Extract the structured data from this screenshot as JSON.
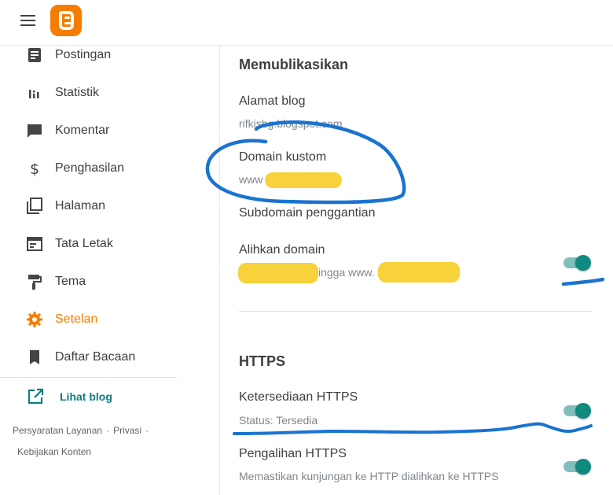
{
  "colors": {
    "accent": "#f57d00",
    "teal": "#0f7c80",
    "toggle_on": "#0f8a7e",
    "annotation": "#1a73d0",
    "redaction": "#f7d23a"
  },
  "sidebar": {
    "items": [
      {
        "label": "Postingan",
        "icon": "posts-icon"
      },
      {
        "label": "Statistik",
        "icon": "stats-icon"
      },
      {
        "label": "Komentar",
        "icon": "comment-icon"
      },
      {
        "label": "Penghasilan",
        "icon": "dollar-icon"
      },
      {
        "label": "Halaman",
        "icon": "pages-icon"
      },
      {
        "label": "Tata Letak",
        "icon": "layout-icon"
      },
      {
        "label": "Tema",
        "icon": "paint-roller-icon"
      },
      {
        "label": "Setelan",
        "icon": "gear-icon",
        "active": true
      },
      {
        "label": "Daftar Bacaan",
        "icon": "bookmark-icon"
      }
    ],
    "view_blog": "Lihat blog",
    "footer": {
      "terms": "Persyaratan Layanan",
      "privacy": "Privasi",
      "content_policy": "Kebijakan Konten",
      "separator": "·"
    }
  },
  "main": {
    "publish": {
      "title": "Memublikasikan",
      "blog_address": {
        "label": "Alamat blog",
        "value": "rifkisbg.blogspot.com"
      },
      "custom_domain": {
        "label": "Domain kustom",
        "value": "www"
      },
      "fallback_subdomain": {
        "label": "Subdomain penggantian"
      },
      "redirect_domain": {
        "label": "Alihkan domain",
        "value_mid": "ingga www.",
        "enabled": true
      }
    },
    "https": {
      "title": "HTTPS",
      "availability": {
        "label": "Ketersediaan HTTPS",
        "status": "Status: Tersedia",
        "enabled": true
      },
      "redirect": {
        "label": "Pengalihan HTTPS",
        "description": "Memastikan kunjungan ke HTTP dialihkan ke HTTPS",
        "enabled": true
      }
    }
  }
}
